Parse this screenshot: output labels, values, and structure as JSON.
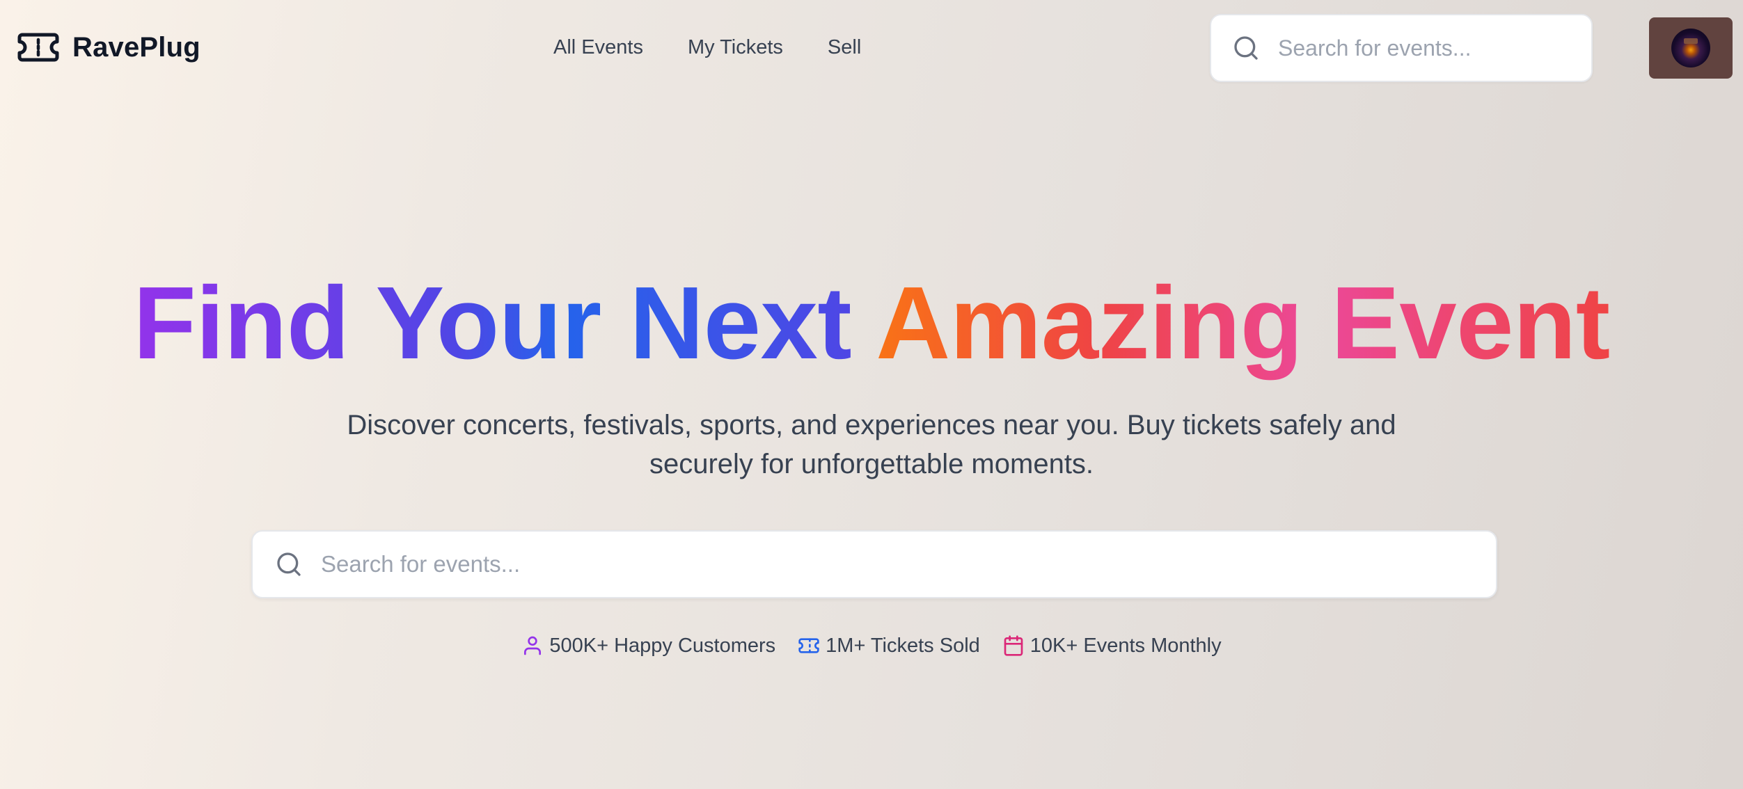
{
  "brand": {
    "name": "RavePlug",
    "icon": "ticket-icon"
  },
  "nav": {
    "items": [
      {
        "label": "All Events"
      },
      {
        "label": "My Tickets"
      },
      {
        "label": "Sell"
      }
    ]
  },
  "header_search": {
    "placeholder": "Search for events...",
    "icon": "search-icon"
  },
  "user": {
    "avatar": "user-avatar"
  },
  "hero": {
    "title_part1": "Find Your Next",
    "title_part2": "Amazing Event",
    "subtitle": "Discover concerts, festivals, sports, and experiences near you. Buy tickets safely and securely for unforgettable moments."
  },
  "hero_search": {
    "placeholder": "Search for events...",
    "icon": "search-icon"
  },
  "stats": [
    {
      "icon": "user-icon",
      "label": "500K+ Happy Customers",
      "color": "#9333ea"
    },
    {
      "icon": "ticket-icon",
      "label": "1M+ Tickets Sold",
      "color": "#2563eb"
    },
    {
      "icon": "calendar-icon",
      "label": "10K+ Events Monthly",
      "color": "#db2777"
    }
  ],
  "colors": {
    "title_gradient_1": [
      "#9333ea",
      "#2563eb"
    ],
    "title_gradient_2": [
      "#f97316",
      "#ec4899",
      "#ef4444"
    ]
  }
}
